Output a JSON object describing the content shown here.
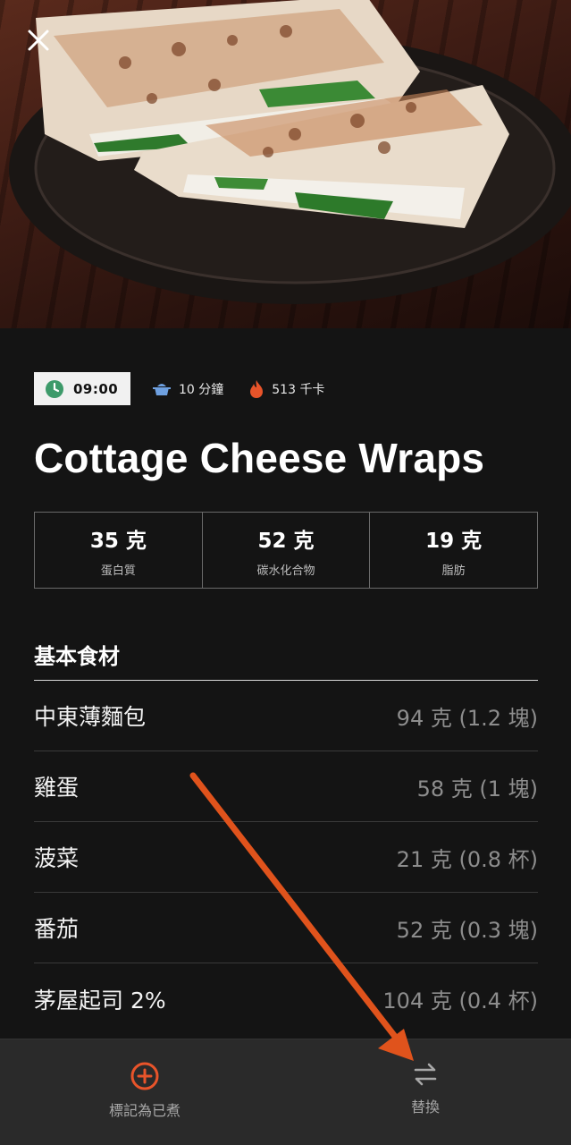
{
  "recipe": {
    "title": "Cottage Cheese Wraps",
    "time": "09:00",
    "cook_time": "10 分鐘",
    "calories": "513 千卡"
  },
  "macros": [
    {
      "value": "35 克",
      "label": "蛋白質"
    },
    {
      "value": "52 克",
      "label": "碳水化合物"
    },
    {
      "value": "19 克",
      "label": "脂肪"
    }
  ],
  "ingredients_section": {
    "title": "基本食材",
    "items": [
      {
        "name": "中東薄麵包",
        "qty": "94 克 (1.2 塊)"
      },
      {
        "name": "雞蛋",
        "qty": "58 克 (1 塊)"
      },
      {
        "name": "菠菜",
        "qty": "21 克 (0.8 杯)"
      },
      {
        "name": "番茄",
        "qty": "52 克 (0.3 塊)"
      },
      {
        "name": "茅屋起司 2%",
        "qty": "104 克 (0.4 杯)"
      }
    ]
  },
  "bottom_bar": {
    "mark_cooked": "標記為已煮",
    "swap": "替換"
  },
  "colors": {
    "accent": "#e8542a",
    "clock": "#3d9a6a",
    "pot": "#6ea0e0",
    "arrow": "#e0531c"
  },
  "icons": [
    "close-icon",
    "clock-icon",
    "pot-icon",
    "flame-icon",
    "plus-circle-icon",
    "swap-icon"
  ]
}
